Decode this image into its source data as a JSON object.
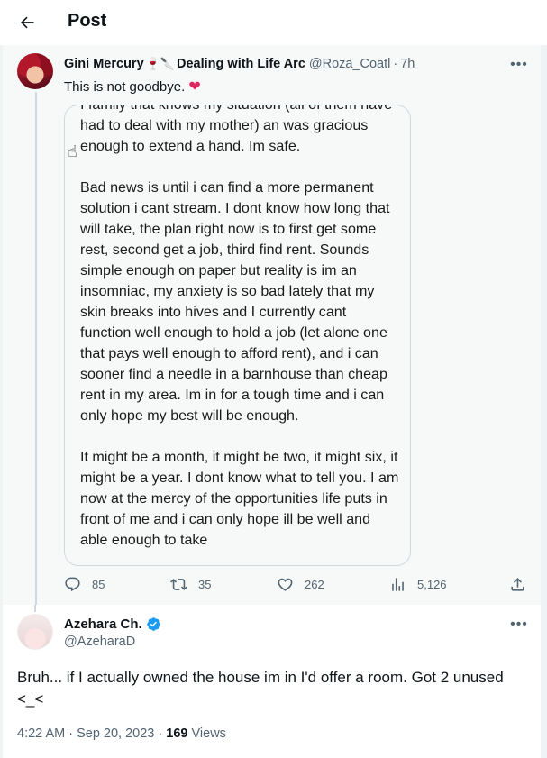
{
  "header": {
    "title": "Post"
  },
  "parent_post": {
    "display_name": "Gini Mercury",
    "emoji_badges": "🍷🔪",
    "name_suffix": "Dealing with Life Arc",
    "handle": "@Roza_Coatl",
    "time": "7h",
    "text": "This is not goodbye.",
    "text_emoji": "❤",
    "image_text": [
      "I family that knows my situation (all of them have had to deal with my mother) an was gracious enough to extend a hand. Im safe.",
      "Bad news is until i can find a more permanent solution i cant stream. I dont know how long that will take, the plan right now is to first get some rest, second get a job, third find rent. Sounds simple enough on paper but reality is im an insomniac, my anxiety is so bad lately that my skin breaks into hives and I currently cant function well enough to hold a job (let alone one that pays well enough to afford rent), and i can sooner find a needle in a barnhouse than cheap rent in my area. Im in for a tough time and i can only hope my best will be enough.",
      "It might be a month, it might be two, it might six, it might be a year. I dont know what to tell you. I am now at the mercy of the opportunities life puts in front of me and i can only hope ill be well and able enough to take"
    ],
    "stats": {
      "replies": "85",
      "reposts": "35",
      "likes": "262",
      "views": "5,126"
    }
  },
  "reply_post": {
    "display_name": "Azehara Ch.",
    "handle": "@AzeharaD",
    "text": "Bruh... if I actually owned the house im in I'd offer a room.  Got 2 unused <_<",
    "time": "4:22 AM",
    "date": "Sep 20, 2023",
    "views_count": "169",
    "views_label": "Views"
  },
  "colors": {
    "accent": "#1d9bf0",
    "heart": "#e0245e",
    "muted": "#536471"
  }
}
